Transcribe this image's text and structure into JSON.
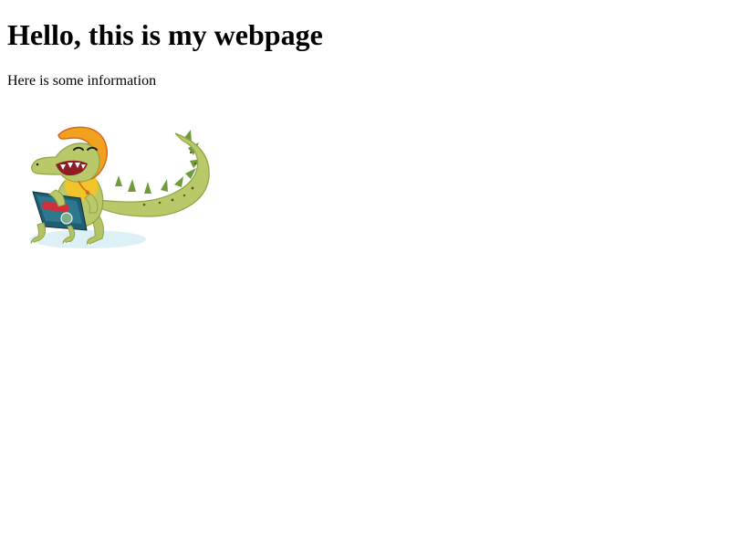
{
  "page": {
    "heading": "Hello, this is my webpage",
    "paragraph": "Here is some information"
  },
  "image": {
    "subject": "cartoon-alligator-with-laptop",
    "colors": {
      "body": "#b9c96a",
      "body_shadow": "#8ea347",
      "spikes": "#6f9b3a",
      "hood": "#f0a21e",
      "hood_dark": "#d7641c",
      "laptop": "#1f5d73",
      "laptop_screen": "#2f7b92",
      "sticker": "#cf2f3a",
      "mouth": "#8f1d24",
      "shadow": "#bfe3ee"
    }
  }
}
